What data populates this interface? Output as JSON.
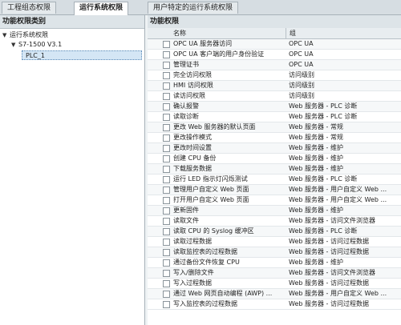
{
  "tabs": [
    {
      "label": "工程组态权限"
    },
    {
      "label": "运行系统权限"
    },
    {
      "label": "用户特定的运行系统权限"
    }
  ],
  "left_pane": {
    "title": "功能权限类别",
    "tree": [
      {
        "label": "运行系统权限",
        "arrow": "▼"
      },
      {
        "label": "S7-1500 V3.1",
        "arrow": "▼"
      },
      {
        "label": "PLC_1",
        "arrow": ""
      }
    ]
  },
  "right_pane": {
    "title": "功能权限",
    "columns": {
      "name": "名称",
      "group": "组"
    },
    "rows": [
      {
        "name": "OPC UA 服务器访问",
        "group": "OPC UA"
      },
      {
        "name": "OPC UA 客户端的用户身份验证",
        "group": "OPC UA"
      },
      {
        "name": "管理证书",
        "group": "OPC UA"
      },
      {
        "name": "完全访问权限",
        "group": "访问级别"
      },
      {
        "name": "HMI 访问权限",
        "group": "访问级别"
      },
      {
        "name": "读访问权限",
        "group": "访问级别"
      },
      {
        "name": "确认报警",
        "group": "Web 服务器 - PLC 诊断"
      },
      {
        "name": "读取诊断",
        "group": "Web 服务器 - PLC 诊断"
      },
      {
        "name": "更改 Web 服务器的默认页面",
        "group": "Web 服务器 - 常规"
      },
      {
        "name": "更改操作模式",
        "group": "Web 服务器 - 常规"
      },
      {
        "name": "更改时间设置",
        "group": "Web 服务器 - 维护"
      },
      {
        "name": "创建 CPU 备份",
        "group": "Web 服务器 - 维护"
      },
      {
        "name": "下载服务数据",
        "group": "Web 服务器 - 维护"
      },
      {
        "name": "运行 LED 指示灯闪烁测试",
        "group": "Web 服务器 - PLC 诊断"
      },
      {
        "name": "管理用户自定义 Web 页面",
        "group": "Web 服务器 - 用户自定义 Web ..."
      },
      {
        "name": "打开用户自定义 Web 页面",
        "group": "Web 服务器 - 用户自定义 Web ..."
      },
      {
        "name": "更新固件",
        "group": "Web 服务器 - 维护"
      },
      {
        "name": "读取文件",
        "group": "Web 服务器 - 访问文件浏览器"
      },
      {
        "name": "读取 CPU 的 Syslog 缓冲区",
        "group": "Web 服务器 - PLC 诊断"
      },
      {
        "name": "读取过程数据",
        "group": "Web 服务器 - 访问过程数据"
      },
      {
        "name": "读取监控表的过程数据",
        "group": "Web 服务器 - 访问过程数据"
      },
      {
        "name": "通过备份文件恢复 CPU",
        "group": "Web 服务器 - 维护"
      },
      {
        "name": "写入/删除文件",
        "group": "Web 服务器 - 访问文件浏览器"
      },
      {
        "name": "写入过程数据",
        "group": "Web 服务器 - 访问过程数据"
      },
      {
        "name": "通过 Web 网页自动编程 (AWP) ...",
        "group": "Web 服务器 - 用户自定义 Web ..."
      },
      {
        "name": "写入监控表的过程数据",
        "group": "Web 服务器 - 访问过程数据"
      }
    ]
  }
}
